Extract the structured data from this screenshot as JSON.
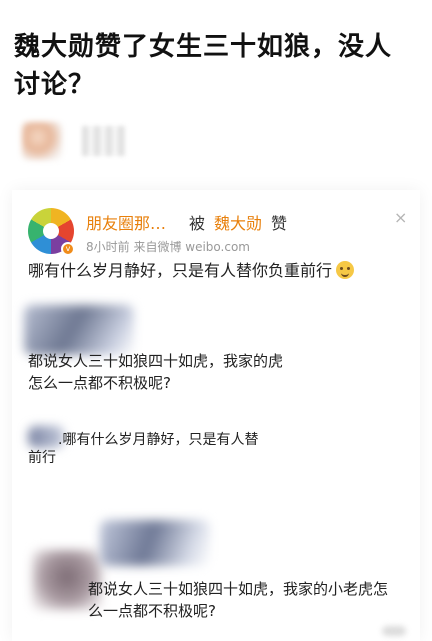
{
  "headline": "魏大勋赞了女生三十如狼，没人讨论？",
  "card": {
    "liker_name": "朋友圈那…",
    "by_word": "被",
    "target_name": "魏大勋",
    "zan_word": "赞",
    "meta": "8小时前  来自微博 weibo.com",
    "close_glyph": "×",
    "badge_glyph": "v",
    "post_text": "哪有什么岁月静好，只是有人替你负重前行",
    "emoji_icon": "smile-emoji"
  },
  "comments": {
    "quote1": "都说女人三十如狼四十如虎，我家的虎怎么一点都不积极呢?",
    "quote2_line1": ".哪有什么岁月静好，只是有人替",
    "quote2_line2": "前行",
    "quote3": "都说女人三十如狼四十如虎，我家的小老虎怎么一点都不积极呢?"
  }
}
